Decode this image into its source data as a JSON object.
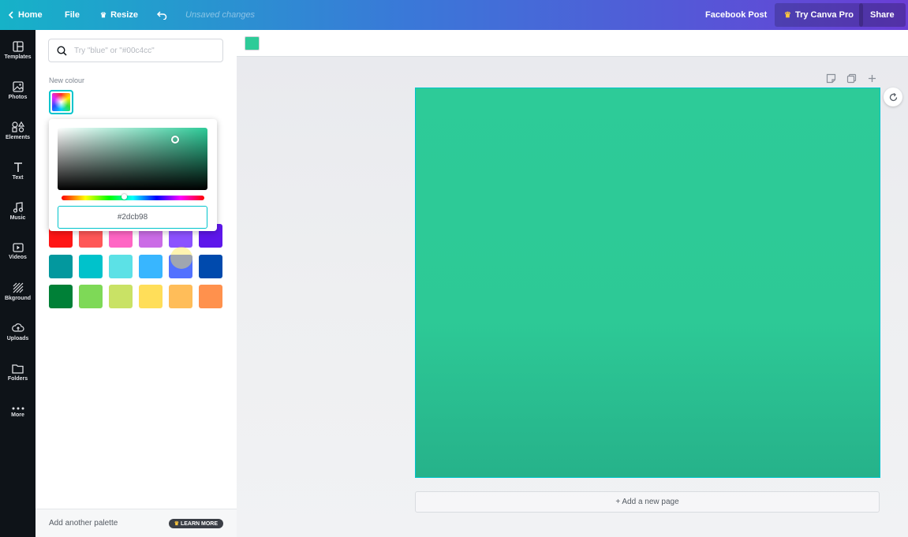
{
  "topbar": {
    "home": "Home",
    "file": "File",
    "resize": "Resize",
    "unsaved": "Unsaved changes",
    "design_type": "Facebook Post",
    "try_pro": "Try Canva Pro",
    "share": "Share"
  },
  "rail": {
    "items": [
      {
        "label": "Templates",
        "icon": "templates-icon"
      },
      {
        "label": "Photos",
        "icon": "photos-icon"
      },
      {
        "label": "Elements",
        "icon": "elements-icon"
      },
      {
        "label": "Text",
        "icon": "text-icon"
      },
      {
        "label": "Music",
        "icon": "music-icon"
      },
      {
        "label": "Videos",
        "icon": "videos-icon"
      },
      {
        "label": "Bkground",
        "icon": "background-icon"
      },
      {
        "label": "Uploads",
        "icon": "uploads-icon"
      },
      {
        "label": "Folders",
        "icon": "folders-icon"
      },
      {
        "label": "More",
        "icon": "more-icon"
      }
    ]
  },
  "panel": {
    "search_placeholder": "Try \"blue\" or \"#00c4cc\"",
    "new_colour_label": "New colour",
    "picker": {
      "hex_value": "#2dcb98",
      "hue_position": 0.44
    },
    "palette_rows": [
      [
        "#ff1616",
        "#ff5757",
        "#ff66c4",
        "#cb6ce6",
        "#8c52ff",
        "#5e17eb"
      ],
      [
        "#03989e",
        "#00c2cb",
        "#5ce1e6",
        "#38b6ff",
        "#5271ff",
        "#004aad"
      ],
      [
        "#008037",
        "#7ed957",
        "#c9e265",
        "#ffde59",
        "#ffbd59",
        "#ff914d"
      ]
    ],
    "footer": {
      "add_palette": "Add another palette",
      "learn_more": "LEARN MORE"
    }
  },
  "toolbar": {
    "current_color": "#2dcb98"
  },
  "canvas": {
    "background_color": "#2dcb98",
    "add_page": "+ Add a new page"
  }
}
